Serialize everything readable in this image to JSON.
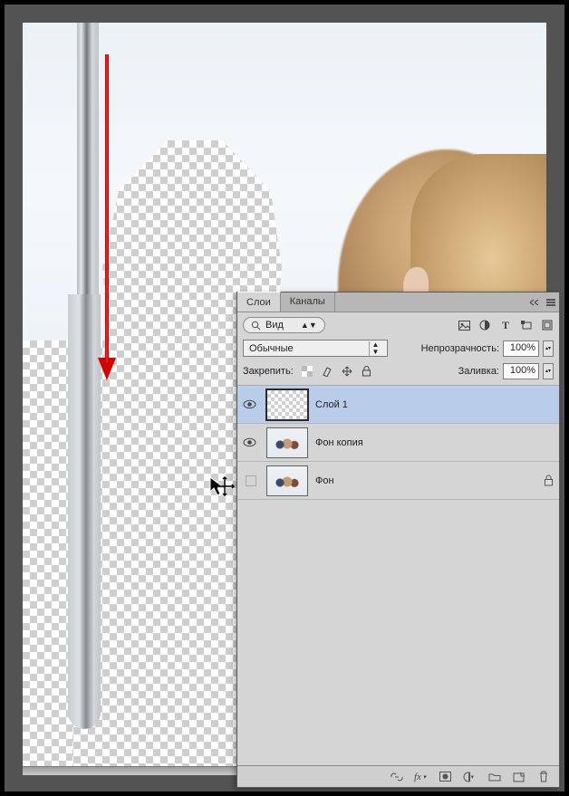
{
  "panel": {
    "tabs": {
      "layers": "Слои",
      "channels": "Каналы"
    },
    "filter": {
      "view_label": "Вид",
      "icons": [
        "image-icon",
        "adjust-icon",
        "type-icon",
        "shape-icon",
        "smartobj-icon"
      ]
    },
    "blend": {
      "mode": "Обычные",
      "opacity_label": "Непрозрачность:",
      "opacity_value": "100%"
    },
    "lock": {
      "label": "Закрепить:",
      "fill_label": "Заливка:",
      "fill_value": "100%"
    },
    "layers": [
      {
        "name": "Слой 1",
        "visible": true,
        "selected": true,
        "locked": false,
        "thumb": "checker"
      },
      {
        "name": "Фон копия",
        "visible": true,
        "selected": false,
        "locked": false,
        "thumb": "photo"
      },
      {
        "name": "Фон",
        "visible": false,
        "selected": false,
        "locked": true,
        "thumb": "photo"
      }
    ],
    "footer_icons": [
      "link-icon",
      "fx-icon",
      "mask-icon",
      "adjustlayer-icon",
      "group-icon",
      "newlayer-icon",
      "trash-icon"
    ]
  }
}
